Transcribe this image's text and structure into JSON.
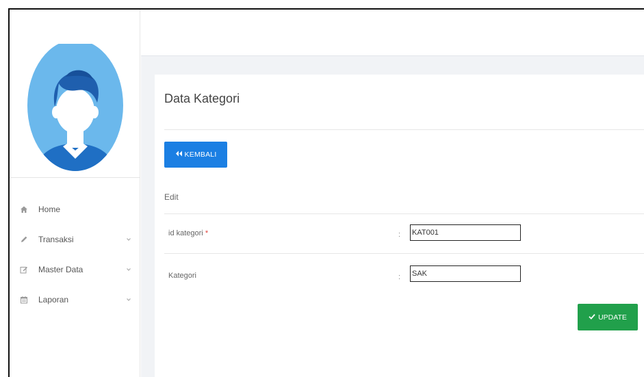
{
  "sidebar": {
    "nav": [
      {
        "label": "Home",
        "icon": "home-icon",
        "has_submenu": false
      },
      {
        "label": "Transaksi",
        "icon": "pencil-icon",
        "has_submenu": true
      },
      {
        "label": "Master Data",
        "icon": "edit-icon",
        "has_submenu": true
      },
      {
        "label": "Laporan",
        "icon": "calendar-icon",
        "has_submenu": true
      }
    ]
  },
  "card": {
    "title": "Data Kategori",
    "back_button": "KEMBALI",
    "section_label": "Edit",
    "fields": [
      {
        "label": "id kategori",
        "required_mark": "*",
        "colon": ":",
        "value": "KAT001"
      },
      {
        "label": "Kategori",
        "required_mark": "",
        "colon": ":",
        "value": "SAK"
      }
    ],
    "update_button": "UPDATE"
  },
  "colors": {
    "primary": "#1b7fe3",
    "success": "#21a04b",
    "required": "#e0413a",
    "avatar_bg": "#6bb8ec"
  }
}
